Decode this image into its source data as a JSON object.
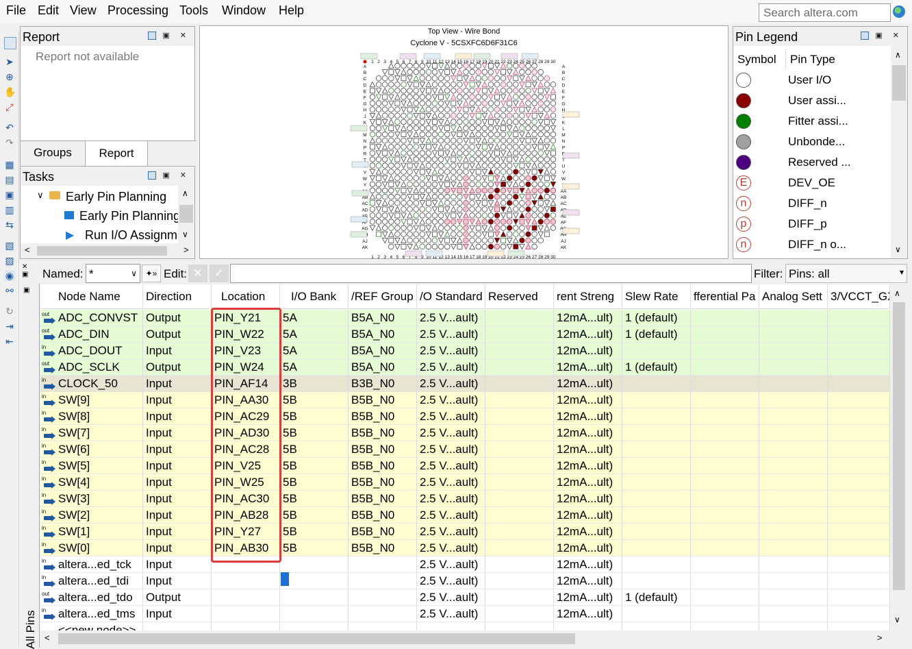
{
  "menu": [
    "File",
    "Edit",
    "View",
    "Processing",
    "Tools",
    "Window",
    "Help"
  ],
  "search_placeholder": "Search altera.com",
  "report": {
    "title": "Report",
    "message": "Report not available",
    "tabs": [
      "Groups",
      "Report"
    ]
  },
  "tasks": {
    "title": "Tasks",
    "items": [
      "Early Pin Planning",
      "Early Pin Planning",
      "Run I/O Assignm"
    ]
  },
  "chip": {
    "title1": "Top View - Wire Bond",
    "title2": "Cyclone V - 5CSXFC6D6F31C6",
    "cols": [
      "1",
      "2",
      "3",
      "4",
      "5",
      "6",
      "7",
      "8",
      "9",
      "10",
      "11",
      "12",
      "13",
      "14",
      "15",
      "16",
      "17",
      "18",
      "19",
      "20",
      "21",
      "22",
      "23",
      "24",
      "25",
      "26",
      "27",
      "28",
      "29",
      "30"
    ],
    "rows": [
      "A",
      "B",
      "C",
      "D",
      "E",
      "F",
      "G",
      "H",
      "J",
      "K",
      "L",
      "M",
      "N",
      "P",
      "R",
      "T",
      "U",
      "V",
      "W",
      "Y",
      "AA",
      "AB",
      "AC",
      "AD",
      "AE",
      "AF",
      "AG",
      "AH",
      "AJ",
      "AK"
    ]
  },
  "legend": {
    "title": "Pin Legend",
    "headers": [
      "Symbol",
      "Pin Type"
    ],
    "items": [
      {
        "label": "User I/O",
        "color": "#ffffff",
        "letter": ""
      },
      {
        "label": "User assi...",
        "color": "#8b0000",
        "letter": ""
      },
      {
        "label": "Fitter assi...",
        "color": "#008000",
        "letter": ""
      },
      {
        "label": "Unbonde...",
        "color": "#a0a0a0",
        "letter": ""
      },
      {
        "label": "Reserved ...",
        "color": "#4b0082",
        "letter": ""
      },
      {
        "label": "DEV_OE",
        "color": "#ffffff",
        "letter": "E"
      },
      {
        "label": "DIFF_n",
        "color": "#ffffff",
        "letter": "n"
      },
      {
        "label": "DIFF_p",
        "color": "#ffffff",
        "letter": "p"
      },
      {
        "label": "DIFF_n o...",
        "color": "#ffffff",
        "letter": "n"
      }
    ]
  },
  "toolbar": {
    "named_label": "Named:",
    "named_value": "*",
    "edit_label": "Edit:",
    "filter_label": "Filter:",
    "filter_value": "Pins: all"
  },
  "side_tab": "All Pins",
  "table": {
    "headers": [
      "Node Name",
      "Direction",
      "Location",
      "I/O Bank",
      "VREF Group",
      "I/O Standard",
      "Reserved",
      "Current Strength",
      "Slew Rate",
      "Differential Pair",
      "Analog Settings",
      "VCCR/VCCT_GXB"
    ],
    "header_display": [
      "Node Name",
      "Direction",
      "Location",
      "I/O Bank",
      "/REF Group",
      "/O Standard",
      "Reserved",
      "rent Streng",
      "Slew Rate",
      "fferential Pa",
      "Analog Sett",
      "3/VCCT_GX"
    ],
    "rows": [
      {
        "dir": "out",
        "name": "ADC_CONVST",
        "direction": "Output",
        "location": "PIN_Y21",
        "bank": "5A",
        "vref": "B5A_N0",
        "std": "2.5 V...ault)",
        "reserved": "",
        "current": "12mA...ult)",
        "slew": "1 (default)",
        "bg": "#e4fbd4"
      },
      {
        "dir": "out",
        "name": "ADC_DIN",
        "direction": "Output",
        "location": "PIN_W22",
        "bank": "5A",
        "vref": "B5A_N0",
        "std": "2.5 V...ault)",
        "reserved": "",
        "current": "12mA...ult)",
        "slew": "1 (default)",
        "bg": "#e4fbd4"
      },
      {
        "dir": "in",
        "name": "ADC_DOUT",
        "direction": "Input",
        "location": "PIN_V23",
        "bank": "5A",
        "vref": "B5A_N0",
        "std": "2.5 V...ault)",
        "reserved": "",
        "current": "12mA...ult)",
        "slew": "",
        "bg": "#e4fbd4"
      },
      {
        "dir": "out",
        "name": "ADC_SCLK",
        "direction": "Output",
        "location": "PIN_W24",
        "bank": "5A",
        "vref": "B5A_N0",
        "std": "2.5 V...ault)",
        "reserved": "",
        "current": "12mA...ult)",
        "slew": "1 (default)",
        "bg": "#e4fbd4"
      },
      {
        "dir": "in",
        "name": "CLOCK_50",
        "direction": "Input",
        "location": "PIN_AF14",
        "bank": "3B",
        "vref": "B3B_N0",
        "std": "2.5 V...ault)",
        "reserved": "",
        "current": "12mA...ult)",
        "slew": "",
        "bg": "#e5e5d2"
      },
      {
        "dir": "in",
        "name": "SW[9]",
        "direction": "Input",
        "location": "PIN_AA30",
        "bank": "5B",
        "vref": "B5B_N0",
        "std": "2.5 V...ault)",
        "reserved": "",
        "current": "12mA...ult)",
        "slew": "",
        "bg": "#fdfdcf"
      },
      {
        "dir": "in",
        "name": "SW[8]",
        "direction": "Input",
        "location": "PIN_AC29",
        "bank": "5B",
        "vref": "B5B_N0",
        "std": "2.5 V...ault)",
        "reserved": "",
        "current": "12mA...ult)",
        "slew": "",
        "bg": "#fdfdcf"
      },
      {
        "dir": "in",
        "name": "SW[7]",
        "direction": "Input",
        "location": "PIN_AD30",
        "bank": "5B",
        "vref": "B5B_N0",
        "std": "2.5 V...ault)",
        "reserved": "",
        "current": "12mA...ult)",
        "slew": "",
        "bg": "#fdfdcf"
      },
      {
        "dir": "in",
        "name": "SW[6]",
        "direction": "Input",
        "location": "PIN_AC28",
        "bank": "5B",
        "vref": "B5B_N0",
        "std": "2.5 V...ault)",
        "reserved": "",
        "current": "12mA...ult)",
        "slew": "",
        "bg": "#fdfdcf"
      },
      {
        "dir": "in",
        "name": "SW[5]",
        "direction": "Input",
        "location": "PIN_V25",
        "bank": "5B",
        "vref": "B5B_N0",
        "std": "2.5 V...ault)",
        "reserved": "",
        "current": "12mA...ult)",
        "slew": "",
        "bg": "#fdfdcf"
      },
      {
        "dir": "in",
        "name": "SW[4]",
        "direction": "Input",
        "location": "PIN_W25",
        "bank": "5B",
        "vref": "B5B_N0",
        "std": "2.5 V...ault)",
        "reserved": "",
        "current": "12mA...ult)",
        "slew": "",
        "bg": "#fdfdcf"
      },
      {
        "dir": "in",
        "name": "SW[3]",
        "direction": "Input",
        "location": "PIN_AC30",
        "bank": "5B",
        "vref": "B5B_N0",
        "std": "2.5 V...ault)",
        "reserved": "",
        "current": "12mA...ult)",
        "slew": "",
        "bg": "#fdfdcf"
      },
      {
        "dir": "in",
        "name": "SW[2]",
        "direction": "Input",
        "location": "PIN_AB28",
        "bank": "5B",
        "vref": "B5B_N0",
        "std": "2.5 V...ault)",
        "reserved": "",
        "current": "12mA...ult)",
        "slew": "",
        "bg": "#fdfdcf"
      },
      {
        "dir": "in",
        "name": "SW[1]",
        "direction": "Input",
        "location": "PIN_Y27",
        "bank": "5B",
        "vref": "B5B_N0",
        "std": "2.5 V...ault)",
        "reserved": "",
        "current": "12mA...ult)",
        "slew": "",
        "bg": "#fdfdcf"
      },
      {
        "dir": "in",
        "name": "SW[0]",
        "direction": "Input",
        "location": "PIN_AB30",
        "bank": "5B",
        "vref": "B5B_N0",
        "std": "2.5 V...ault)",
        "reserved": "",
        "current": "12mA...ult)",
        "slew": "",
        "bg": "#fdfdcf"
      },
      {
        "dir": "in",
        "name": "altera...ed_tck",
        "direction": "Input",
        "location": "",
        "bank": "",
        "vref": "",
        "std": "2.5 V...ault)",
        "reserved": "",
        "current": "12mA...ult)",
        "slew": "",
        "bg": "#ffffff"
      },
      {
        "dir": "in",
        "name": "altera...ed_tdi",
        "direction": "Input",
        "location": "",
        "bank": "",
        "vref": "",
        "std": "2.5 V...ault)",
        "reserved": "",
        "current": "12mA...ult)",
        "slew": "",
        "bg": "#ffffff"
      },
      {
        "dir": "out",
        "name": "altera...ed_tdo",
        "direction": "Output",
        "location": "",
        "bank": "",
        "vref": "",
        "std": "2.5 V...ault)",
        "reserved": "",
        "current": "12mA...ult)",
        "slew": "1 (default)",
        "bg": "#ffffff"
      },
      {
        "dir": "in",
        "name": "altera...ed_tms",
        "direction": "Input",
        "location": "",
        "bank": "",
        "vref": "",
        "std": "2.5 V...ault)",
        "reserved": "",
        "current": "12mA...ult)",
        "slew": "",
        "bg": "#ffffff"
      },
      {
        "dir": "",
        "name": "<<new node>>",
        "direction": "",
        "location": "",
        "bank": "",
        "vref": "",
        "std": "",
        "reserved": "",
        "current": "",
        "slew": "",
        "bg": "#ffffff"
      }
    ]
  },
  "colors": {
    "highlight_box": "#e03a3a",
    "accent": "#1f5aa3"
  }
}
